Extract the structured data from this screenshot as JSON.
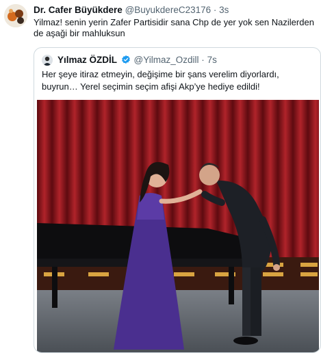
{
  "tweet": {
    "author_name": "Dr. Cafer Büyükdere",
    "author_handle": "@BuyukdereC23176",
    "separator": "·",
    "time": "3s",
    "text": "Yilmaz! senin yerin Zafer Partisidir sana Chp de yer yok sen Nazilerden de aşaği bir mahluksun",
    "avatar_icon": "cartoon-avatar-icon"
  },
  "quoted_tweet": {
    "author_name": "Yılmaz ÖZDİL",
    "author_handle": "@Yilmaz_Ozdill",
    "separator": "·",
    "time": "7s",
    "verified": true,
    "verified_color": "#1d9bf0",
    "text": "Her şeye itiraz etmeyin, değişime bir şans verelim diyorlardı, buyrun… Yerel seçimin seçim afişi Akp’ye hediye edildi!",
    "photo_icon": "stage-photo"
  },
  "colors": {
    "text": "#0f1419",
    "secondary": "#536471",
    "border": "#cfd9de",
    "curtain": "#9b1c22"
  }
}
